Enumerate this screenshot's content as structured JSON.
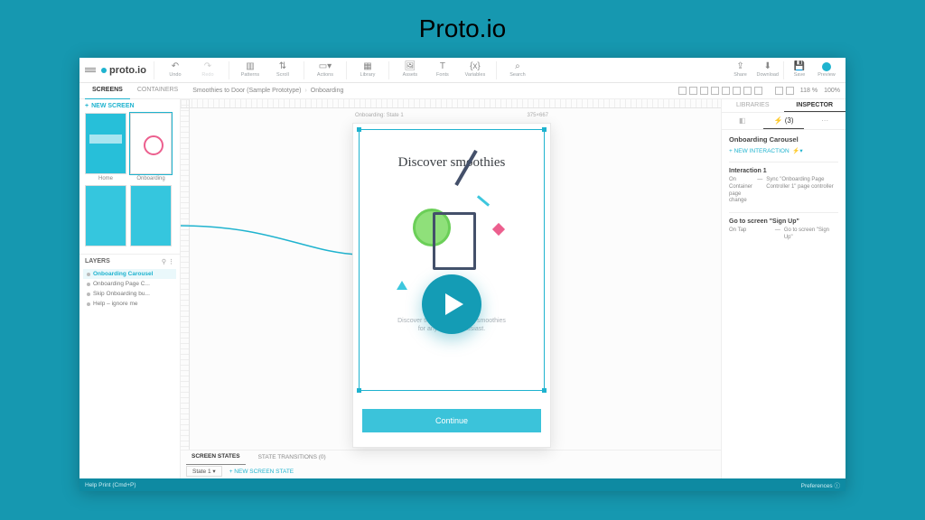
{
  "page_title": "Proto.io",
  "logo": "proto.io",
  "toolbar": {
    "undo": "Undo",
    "redo": "Redo",
    "patterns": "Patterns",
    "scroll": "Scroll",
    "actions": "Actions",
    "library": "Library",
    "assets": "Assets",
    "fonts": "Fonts",
    "variables": "Variables",
    "search": "Search",
    "share": "Share",
    "download": "Download",
    "save": "Save",
    "preview": "Preview"
  },
  "tabs": {
    "screens": "SCREENS",
    "containers": "CONTAINERS"
  },
  "breadcrumb": {
    "project": "Smoothies to Door (Sample Prototype)",
    "screen": "Onboarding"
  },
  "zoom": {
    "percent": "118",
    "unit": "%",
    "reset": "100%"
  },
  "screens_panel": {
    "new_screen": "NEW SCREEN",
    "thumbs": [
      {
        "label": "Home"
      },
      {
        "label": "Onboarding"
      },
      {
        "label": ""
      },
      {
        "label": ""
      }
    ]
  },
  "layers": {
    "title": "LAYERS",
    "items": [
      "Onboarding Carousel",
      "Onboarding Page C...",
      "Skip Onboarding bu...",
      "Help – ignore me"
    ]
  },
  "canvas": {
    "state_label": "Onboarding: State 1",
    "dims": "375×667",
    "hero_title": "Discover smoothies",
    "subcopy_l1": "Discover thousands of tasty smoothies",
    "subcopy_l2": "for any drink enthusiast.",
    "continue": "Continue"
  },
  "state_bar": {
    "screen_states": "SCREEN STATES",
    "transitions": "STATE TRANSITIONS (0)",
    "current": "State 1",
    "new_state": "NEW SCREEN STATE"
  },
  "status": {
    "left": "Help    Print (Cmd+P)",
    "right": "Preferences"
  },
  "right": {
    "tab_libraries": "LIBRARIES",
    "tab_inspector": "INSPECTOR",
    "sub_interactions_count": "(3)",
    "sel_title": "Onboarding Carousel",
    "new_interaction": "NEW INTERACTION",
    "int1": {
      "title": "Interaction 1",
      "trigger_l": "On Container page change",
      "action": "Sync \"Onboarding Page Controller 1\" page controller"
    },
    "int2": {
      "title": "Go to screen \"Sign Up\"",
      "trigger_l": "On Tap",
      "action": "Go to screen \"Sign Up\""
    }
  }
}
